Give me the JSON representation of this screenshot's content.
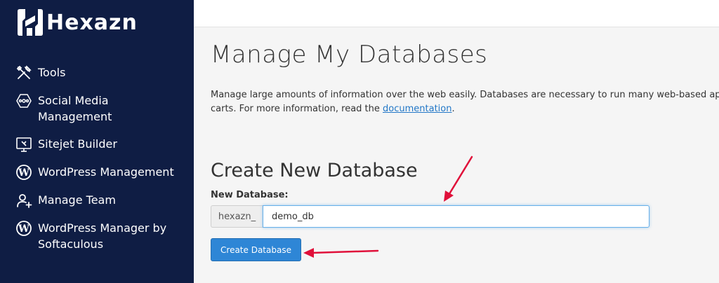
{
  "brand": {
    "name": "Hexazn"
  },
  "sidebar": {
    "items": [
      {
        "label": "Tools",
        "icon": "tools-icon"
      },
      {
        "label": "Social Media Management",
        "icon": "social-media-icon"
      },
      {
        "label": "Sitejet Builder",
        "icon": "sitejet-icon"
      },
      {
        "label": "WordPress Management",
        "icon": "wordpress-icon"
      },
      {
        "label": "Manage Team",
        "icon": "manage-team-icon"
      },
      {
        "label": "WordPress Manager by Softaculous",
        "icon": "wordpress-icon"
      }
    ]
  },
  "main": {
    "title": "Manage My Databases",
    "description_line1": "Manage large amounts of information over the web easily. Databases are necessary to run many web-based applic",
    "description_line2_prefix": "carts. For more information, read the ",
    "description_link": "documentation",
    "description_line2_suffix": ".",
    "create_section": {
      "title": "Create New Database",
      "field_label": "New Database:",
      "prefix": "hexazn_",
      "value": "demo_db",
      "button_label": "Create Database"
    }
  },
  "colors": {
    "sidebar_bg": "#0f1d44",
    "button_bg": "#2e86d6",
    "link": "#2277c7",
    "annotation_arrow": "#e0103a"
  }
}
